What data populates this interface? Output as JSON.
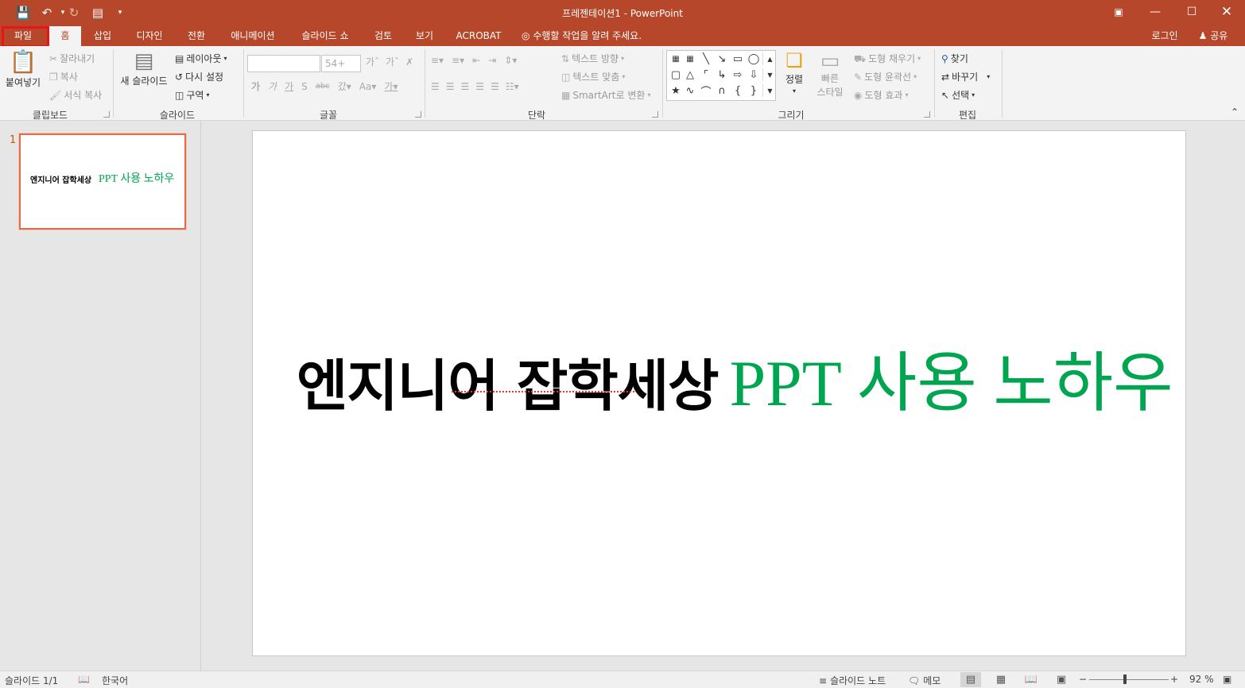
{
  "app": {
    "title": "프레젠테이션1 - PowerPoint"
  },
  "tabs": [
    "파일",
    "홈",
    "삽입",
    "디자인",
    "전환",
    "애니메이션",
    "슬라이드 쇼",
    "검토",
    "보기",
    "ACROBAT"
  ],
  "tell_me": "수행할 작업을 알려 주세요.",
  "account": {
    "login": "로그인",
    "share": "공유"
  },
  "ribbon": {
    "clipboard": {
      "label": "클립보드",
      "paste": "붙여넣기",
      "cut": "잘라내기",
      "copy": "복사",
      "format_painter": "서식 복사"
    },
    "slides": {
      "label": "슬라이드",
      "new_slide": "새 슬라이드",
      "layout": "레이아웃",
      "reset": "다시 설정",
      "section": "구역"
    },
    "font": {
      "label": "글꼴",
      "font_name": "",
      "font_size": "54+"
    },
    "paragraph": {
      "label": "단락",
      "text_direction": "텍스트 방향",
      "align_text": "텍스트 맞춤",
      "smartart": "SmartArt로 변환"
    },
    "drawing": {
      "label": "그리기",
      "arrange": "정렬",
      "quick_styles_1": "빠른",
      "quick_styles_2": "스타일",
      "shape_fill": "도형 채우기",
      "shape_outline": "도형 윤곽선",
      "shape_effects": "도형 효과"
    },
    "editing": {
      "label": "편집",
      "find": "찾기",
      "replace": "바꾸기",
      "select": "선택"
    }
  },
  "thumbnail": {
    "number": "1",
    "text_black": "엔지니어 잡학세상",
    "text_green": "PPT 사용 노하우"
  },
  "slide": {
    "title_black": "엔지니어 잡학세상",
    "title_green": "PPT 사용 노하우"
  },
  "status": {
    "slide_count": "슬라이드 1/1",
    "language": "한국어",
    "notes": "슬라이드 노트",
    "comments": "메모",
    "zoom": "92 %"
  },
  "colors": {
    "accent": "#b7472a",
    "title_green": "#00a550",
    "highlight": "#e8141a"
  }
}
